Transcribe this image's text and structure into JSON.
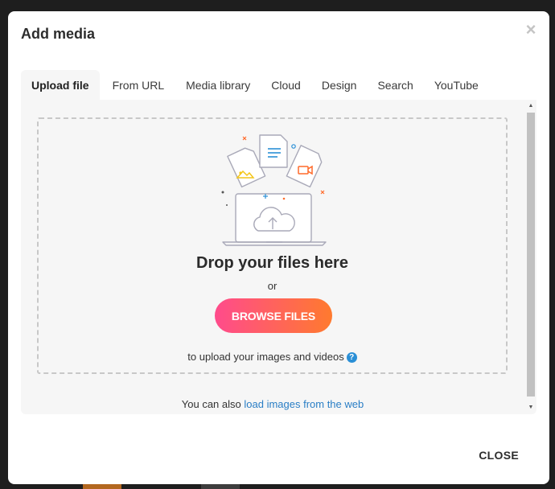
{
  "dialog": {
    "title": "Add media",
    "close_icon": "close-icon",
    "close_button": "CLOSE"
  },
  "tabs": [
    {
      "label": "Upload file",
      "active": true
    },
    {
      "label": "From URL"
    },
    {
      "label": "Media library"
    },
    {
      "label": "Cloud"
    },
    {
      "label": "Design"
    },
    {
      "label": "Search"
    },
    {
      "label": "YouTube"
    }
  ],
  "dropzone": {
    "heading": "Drop your files here",
    "or": "or",
    "browse_label": "BROWSE FILES",
    "hint": "to upload your images and videos",
    "help_icon": "question-icon"
  },
  "footer_note": {
    "text": "You can also",
    "link": "load images from the web"
  },
  "colors": {
    "button_gradient_start": "#ff4b8c",
    "button_gradient_end": "#ff7a2e",
    "link": "#2a7ec5",
    "help_icon": "#2a8fd6"
  }
}
